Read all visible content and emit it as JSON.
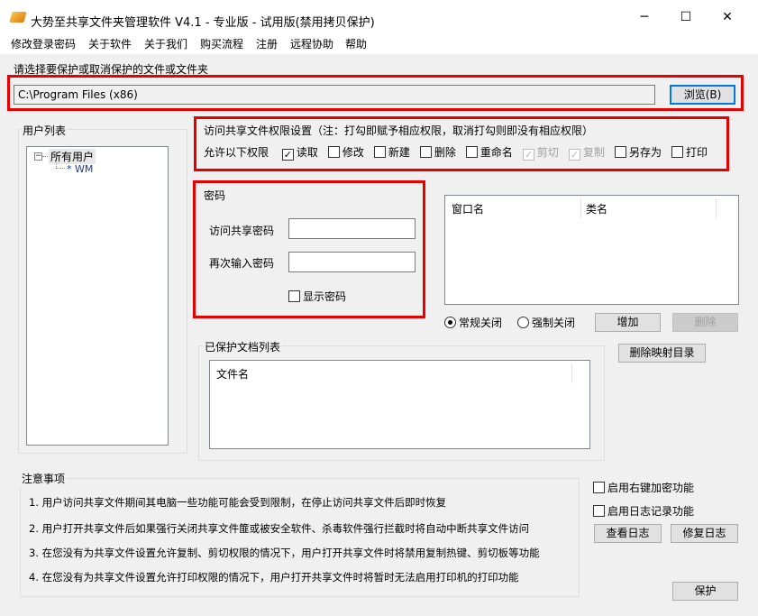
{
  "window": {
    "title": "大势至共享文件夹管理软件 V4.1 - 专业版 - 试用版(禁用拷贝保护)",
    "minimize": "─",
    "maximize": "☐",
    "close": "✕"
  },
  "menu": [
    "修改登录密码",
    "关于软件",
    "关于我们",
    "购买流程",
    "注册",
    "远程协助",
    "帮助"
  ],
  "path": {
    "label": "请选择要保护或取消保护的文件或文件夹",
    "value": "C:\\Program Files (x86)",
    "browse": "浏览(B)"
  },
  "users": {
    "title": "用户列表",
    "root": "所有用户",
    "children": [
      "* WM"
    ]
  },
  "permissions": {
    "title": "访问共享文件权限设置（注：打勾即赋予相应权限，取消打勾则即没有相应权限）",
    "row_label": "允许以下权限",
    "items": [
      {
        "label": "读取",
        "checked": true,
        "disabled": false
      },
      {
        "label": "修改",
        "checked": false,
        "disabled": false
      },
      {
        "label": "新建",
        "checked": false,
        "disabled": false
      },
      {
        "label": "删除",
        "checked": false,
        "disabled": false
      },
      {
        "label": "重命名",
        "checked": false,
        "disabled": false
      },
      {
        "label": "剪切",
        "checked": true,
        "disabled": true
      },
      {
        "label": "复制",
        "checked": true,
        "disabled": true
      },
      {
        "label": "另存为",
        "checked": false,
        "disabled": false
      },
      {
        "label": "打印",
        "checked": false,
        "disabled": false
      }
    ]
  },
  "password": {
    "title": "密码",
    "access_label": "访问共享密码",
    "access_value": "",
    "repeat_label": "再次输入密码",
    "repeat_value": "",
    "show_label": "显示密码"
  },
  "windows_list": {
    "columns": [
      "窗口名",
      "类名"
    ],
    "radio_normal": "常规关闭",
    "radio_force": "强制关闭",
    "add": "增加",
    "delete": "删除"
  },
  "protected": {
    "title": "已保护文档列表",
    "columns": [
      "文件名"
    ],
    "delete_map": "删除映射目录"
  },
  "notes": {
    "title": "注意事项",
    "items": [
      "1. 用户访问共享文件期间其电脑一些功能可能会受到限制，在停止访问共享文件后即时恢复",
      "2. 用户打开共享文件后如果强行关闭共享文件篚或被安全软件、杀毒软件强行拦截时将自动中断共享文件访问",
      "3. 在您没有为共享文件设置允许复制、剪切权限的情况下，用户打开共享文件时将禁用复制热键、剪切板等功能",
      "4. 在您没有为共享文件设置允许打印权限的情况下，用户打开共享文件时将暂时无法启用打印机的打印功能"
    ]
  },
  "options": {
    "right_click": "启用右键加密功能",
    "log": "启用日志记录功能",
    "view_log": "查看日志",
    "repair_log": "修复日志",
    "protect": "保护"
  }
}
